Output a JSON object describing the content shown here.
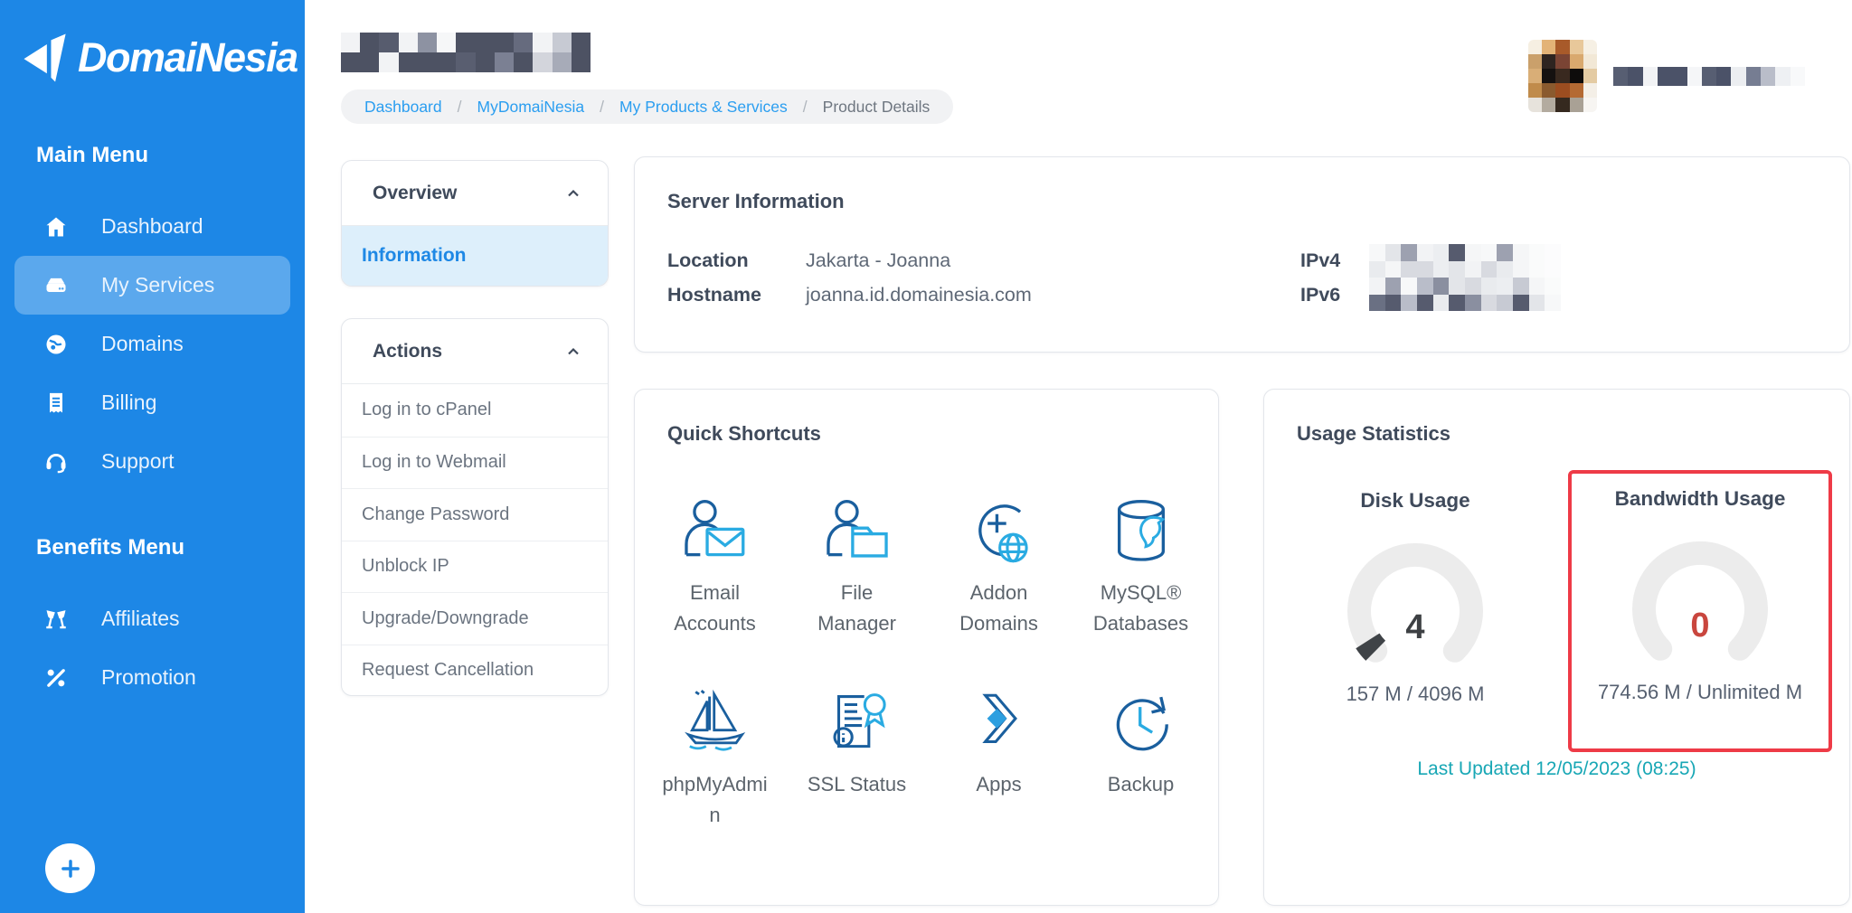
{
  "sidebar": {
    "logo_text": "DomaiNesia",
    "sections": [
      {
        "heading": "Main Menu",
        "items": [
          {
            "label": "Dashboard",
            "icon": "home-icon",
            "active": false
          },
          {
            "label": "My Services",
            "icon": "server-icon",
            "active": true
          },
          {
            "label": "Domains",
            "icon": "globe-icon",
            "active": false
          },
          {
            "label": "Billing",
            "icon": "receipt-icon",
            "active": false
          },
          {
            "label": "Support",
            "icon": "headset-icon",
            "active": false
          }
        ]
      },
      {
        "heading": "Benefits Menu",
        "items": [
          {
            "label": "Affiliates",
            "icon": "cheers-icon",
            "active": false
          },
          {
            "label": "Promotion",
            "icon": "percent-icon",
            "active": false
          }
        ]
      }
    ]
  },
  "breadcrumb": {
    "separator": "/",
    "items": [
      "Dashboard",
      "MyDomaiNesia",
      "My Products & Services",
      "Product Details"
    ]
  },
  "overview_panel": {
    "title": "Overview",
    "items": [
      {
        "label": "Information",
        "active": true
      }
    ]
  },
  "actions_panel": {
    "title": "Actions",
    "items": [
      "Log in to cPanel",
      "Log in to Webmail",
      "Change Password",
      "Unblock IP",
      "Upgrade/Downgrade",
      "Request Cancellation"
    ]
  },
  "server_info": {
    "title": "Server Information",
    "rows": [
      {
        "label": "Location",
        "value": "Jakarta - Joanna"
      },
      {
        "label": "Hostname",
        "value": "joanna.id.domainesia.com"
      }
    ],
    "ip_labels": [
      "IPv4",
      "IPv6"
    ]
  },
  "quick_shortcuts": {
    "title": "Quick Shortcuts",
    "items": [
      {
        "label": "Email Accounts",
        "icon": "email-accounts-icon"
      },
      {
        "label": "File Manager",
        "icon": "file-manager-icon"
      },
      {
        "label": "Addon Domains",
        "icon": "addon-domains-icon"
      },
      {
        "label": "MySQL® Databases",
        "icon": "mysql-databases-icon"
      },
      {
        "label": "phpMyAdmin",
        "icon": "phpmyadmin-icon"
      },
      {
        "label": "SSL Status",
        "icon": "ssl-status-icon"
      },
      {
        "label": "Apps",
        "icon": "apps-icon"
      },
      {
        "label": "Backup",
        "icon": "backup-icon"
      }
    ]
  },
  "usage_statistics": {
    "title": "Usage Statistics",
    "gauges": [
      {
        "label": "Disk Usage",
        "value": "4",
        "detail": "157 M / 4096 M",
        "percent": 3.8,
        "fill_color": "#3f4347",
        "value_color": "#3d4043",
        "highlighted": false
      },
      {
        "label": "Bandwidth Usage",
        "value": "0",
        "detail": "774.56 M / Unlimited M",
        "percent": 0,
        "fill_color": "#3f4347",
        "value_color": "#c9463e",
        "highlighted": true
      }
    ],
    "last_updated": "Last Updated 12/05/2023 (08:25)"
  },
  "colors": {
    "sidebar_blue": "#1d87e6",
    "active_item_overlay": "rgba(255,255,255,0.28)",
    "accent_blue": "#1e88e5",
    "breadcrumb_link_blue": "#2b9ef0",
    "highlight_red_box": "#ee3b47",
    "gauge_track": "#ececec",
    "gauge_fill_dark": "#3f4347",
    "bandwidth_value_red": "#c9463e",
    "last_updated_teal": "#18a7b5",
    "icon_navy": "#1a5f9e",
    "icon_cyan": "#2aabe2"
  },
  "redactions": {
    "page_title": [
      [
        "#f2f3f5",
        "#4d5263",
        "#575c6e",
        "#f2f3f5",
        "#8d92a2",
        "#f6f7f8",
        "#4d5263",
        "#4d5263",
        "#4d5263",
        "#666b7e",
        "#f2f3f5",
        "#c7cad3",
        "#4d5263"
      ],
      [
        "#4d5263",
        "#4d5263",
        "#f2f3f5",
        "#4d5263",
        "#4d5263",
        "#4d5263",
        "#595e70",
        "#4d5263",
        "#7b8093",
        "#4d5263",
        "#d3d5dc",
        "#a7abb8",
        "#4d5263"
      ]
    ],
    "avatar": [
      [
        "#f6efe2",
        "#e3b377",
        "#a85a2a",
        "#e8c89a",
        "#f6f0e4"
      ],
      [
        "#caa06b",
        "#2e2420",
        "#7a4434",
        "#d9a96e",
        "#f2e8d6"
      ],
      [
        "#d9ae77",
        "#151110",
        "#39291f",
        "#0e0c0b",
        "#e4cba3"
      ],
      [
        "#c08b4b",
        "#8a5a2e",
        "#9c4d20",
        "#b46a33",
        "#f4efe7"
      ],
      [
        "#e7e3dc",
        "#b3ab9f",
        "#35291f",
        "#a9a195",
        "#f7f5f2"
      ]
    ],
    "user_name": [
      [
        "#575e72",
        "#4b5268",
        "#f2f3f5",
        "#4b5268",
        "#4b5268",
        "#f5f6f8",
        "#575e72",
        "#4b5268",
        "#eceef1",
        "#767d92",
        "#b9bdc9",
        "#eef0f3",
        "#f8f9fa"
      ]
    ],
    "ip_values": [
      [
        "#f7f8f9",
        "#e3e5e9",
        "#9da1b0",
        "#f2f3f5",
        "#eceef1",
        "#565b6e",
        "#f5f6f7",
        "#f7f8f9",
        "#9da1b0",
        "#f5f6f7",
        "#fafbfb",
        "#fcfcfd"
      ],
      [
        "#e9ebee",
        "#f5f6f7",
        "#d8dae0",
        "#d8dae0",
        "#eceef1",
        "#e3e5e9",
        "#f2f3f5",
        "#d8dae0",
        "#e9ebee",
        "#f5f6f7",
        "#fafbfb",
        "#fcfcfd"
      ],
      [
        "#f2f3f5",
        "#9da1b0",
        "#f7f8f9",
        "#b9bdc9",
        "#8a8fa0",
        "#e3e5e9",
        "#d8dae0",
        "#e9ebee",
        "#eceef1",
        "#c7cad3",
        "#f5f6f7",
        "#fafbfb"
      ],
      [
        "#6a7083",
        "#565b6e",
        "#b9bdc9",
        "#565b6e",
        "#e9ebee",
        "#565b6e",
        "#8a8fa0",
        "#d8dae0",
        "#c7cad3",
        "#565b6e",
        "#e3e5e9",
        "#f7f8f9"
      ]
    ]
  }
}
